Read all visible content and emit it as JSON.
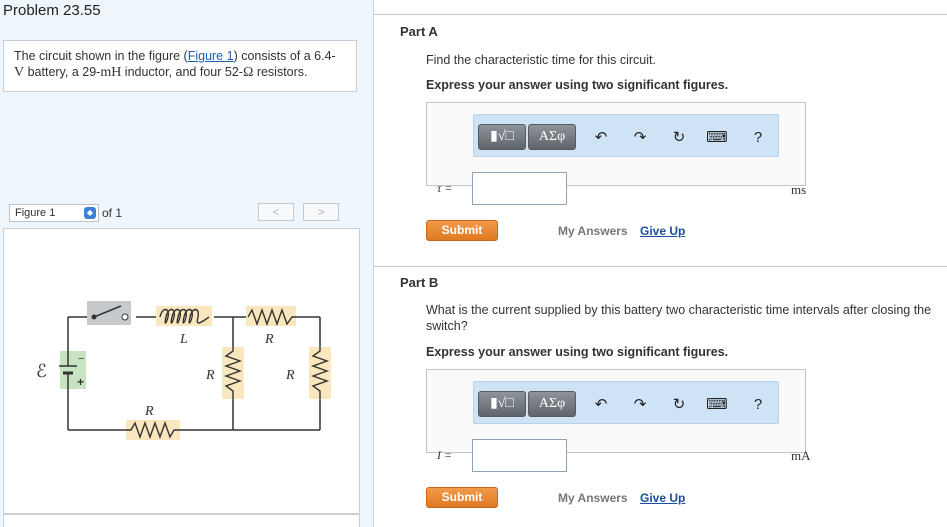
{
  "problem": {
    "title": "Problem 23.55",
    "text_before_link": "The circuit shown in the figure (",
    "link_text": "Figure 1",
    "text_after_link": ") consists of a 6.4-",
    "line2_v": "V",
    "line2_text1": " battery, a 29-",
    "line2_mh": "mH",
    "line2_text2": " inductor, and four 52-",
    "line2_ohm": "Ω",
    "line2_text3": " resistors."
  },
  "figure": {
    "select_value": "Figure 1",
    "of_label": "of 1",
    "prev_label": "<",
    "next_label": ">",
    "labels": {
      "emf": "ℰ",
      "L": "L",
      "R_top": "R",
      "R_mid1": "R",
      "R_mid2": "R",
      "R_bottom": "R",
      "minus": "−",
      "plus": "+"
    }
  },
  "toolbar": {
    "math_btn": "▮√□",
    "greek_btn": "ΑΣφ",
    "undo_icon": "undo-icon",
    "redo_icon": "redo-icon",
    "reset_icon": "reset-icon",
    "keyboard_icon": "keyboard-icon",
    "help_label": "?"
  },
  "partA": {
    "title": "Part A",
    "prompt": "Find the characteristic time for this circuit.",
    "instruction": "Express your answer using two significant figures.",
    "var_label": "τ =",
    "input_value": "",
    "unit": "ms",
    "submit_label": "Submit",
    "my_answers_label": "My Answers",
    "give_up_label": "Give Up"
  },
  "partB": {
    "title": "Part B",
    "prompt": "What is the current supplied by this battery two characteristic time intervals after closing the switch?",
    "instruction": "Express your answer using two significant figures.",
    "var_label": "I =",
    "input_value": "",
    "unit": "mA",
    "submit_label": "Submit",
    "my_answers_label": "My Answers",
    "give_up_label": "Give Up"
  }
}
